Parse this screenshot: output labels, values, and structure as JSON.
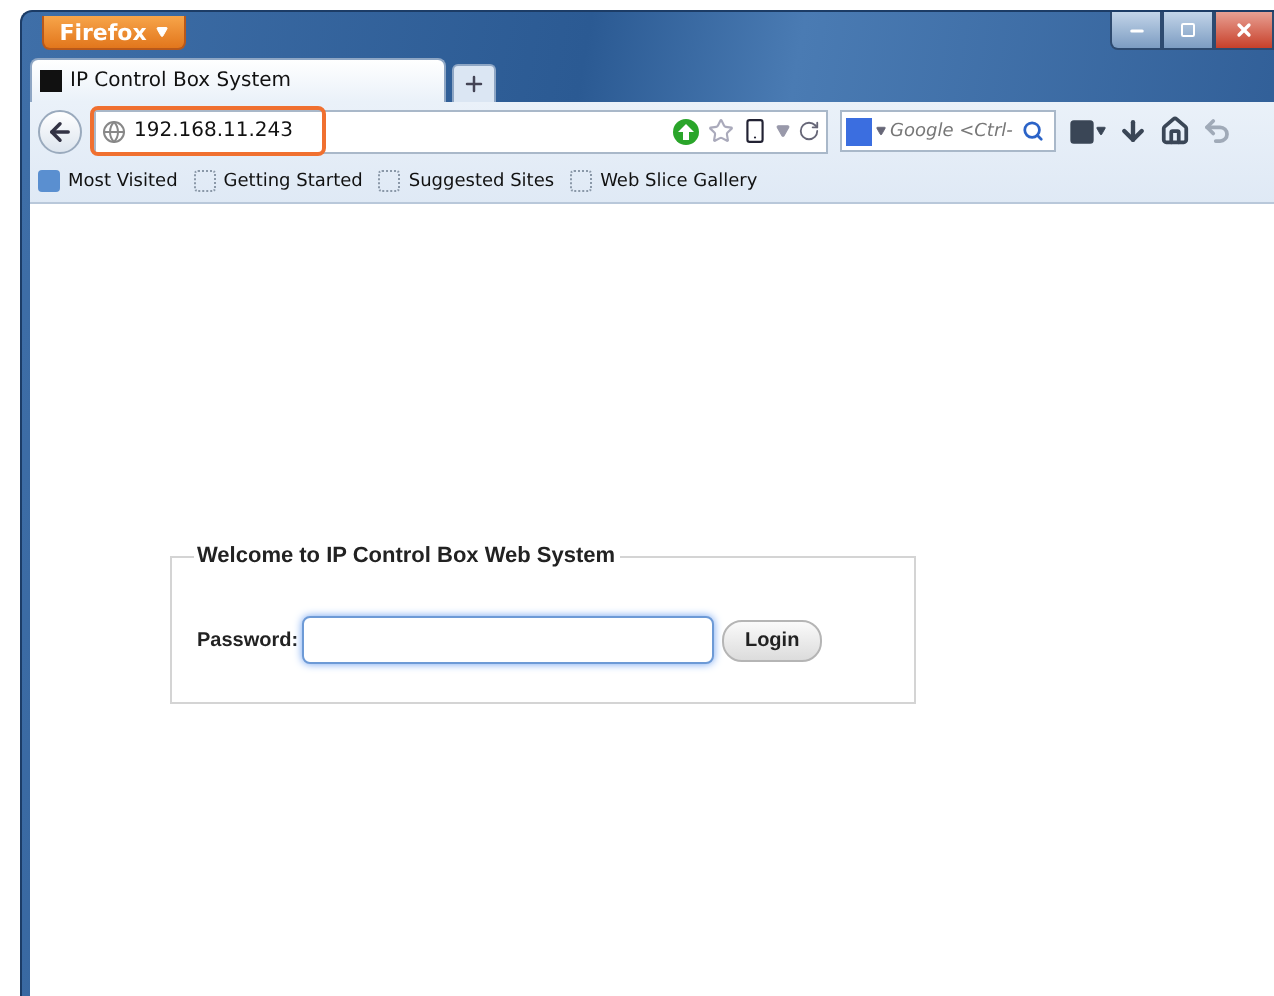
{
  "window": {
    "app_button": "Firefox"
  },
  "tabs": [
    {
      "label": "IP Control Box System",
      "selected": true
    }
  ],
  "address_bar": {
    "value": "192.168.11.243",
    "highlighted": true
  },
  "search_box": {
    "placeholder": "Google <Ctrl-"
  },
  "bookmarks": [
    {
      "label": "Most Visited",
      "kind": "special"
    },
    {
      "label": "Getting Started",
      "kind": "page"
    },
    {
      "label": "Suggested Sites",
      "kind": "page"
    },
    {
      "label": "Web Slice Gallery",
      "kind": "page"
    }
  ],
  "login_form": {
    "legend": "Welcome to IP Control Box Web System",
    "password_label": "Password:",
    "password_focused": true,
    "button": "Login"
  }
}
